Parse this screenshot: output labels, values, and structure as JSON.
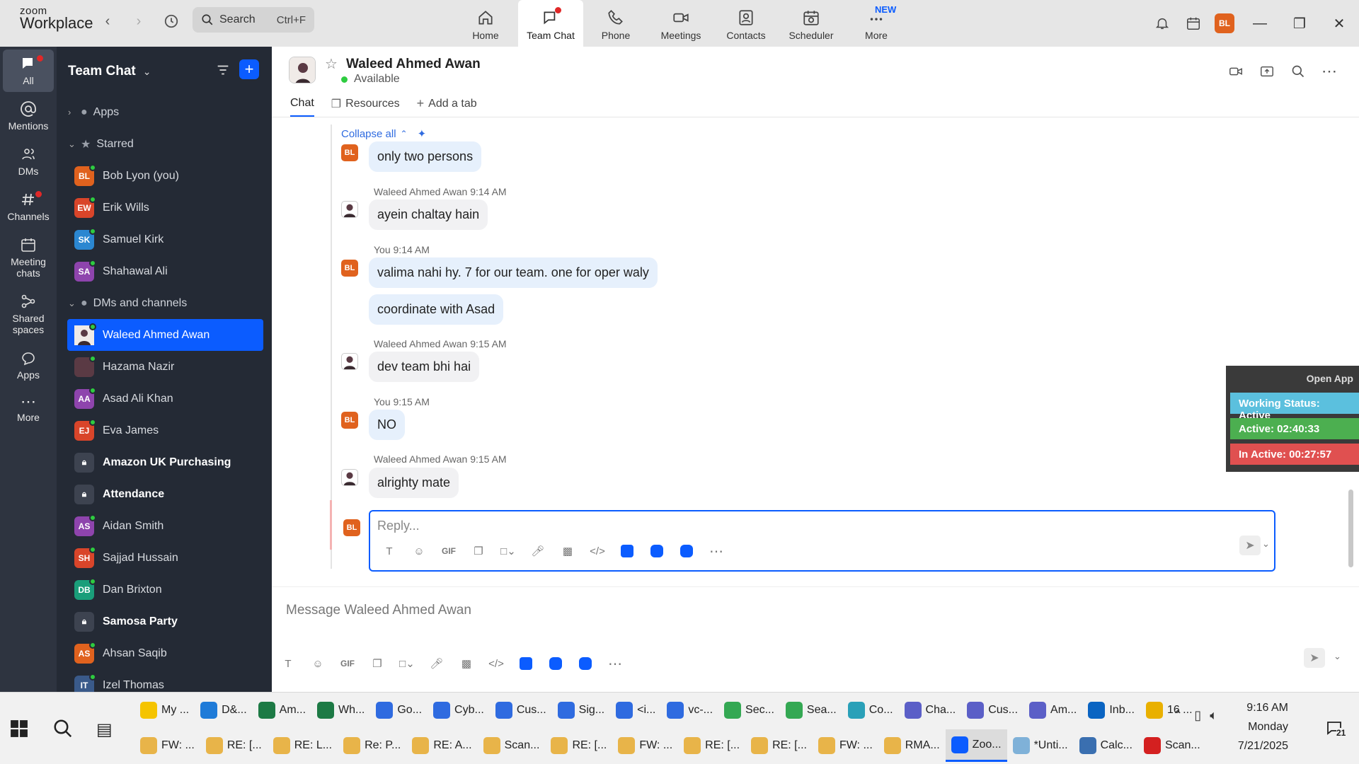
{
  "app": {
    "logo_top": "zoom",
    "logo_bottom": "Workplace"
  },
  "search": {
    "label": "Search",
    "shortcut": "Ctrl+F"
  },
  "tabs": [
    {
      "label": "Home"
    },
    {
      "label": "Team Chat"
    },
    {
      "label": "Phone"
    },
    {
      "label": "Meetings"
    },
    {
      "label": "Contacts"
    },
    {
      "label": "Scheduler"
    },
    {
      "label": "More",
      "badge": "NEW"
    }
  ],
  "user_avatar": "BL",
  "rail": [
    {
      "label": "All"
    },
    {
      "label": "Mentions"
    },
    {
      "label": "DMs"
    },
    {
      "label": "Channels"
    },
    {
      "label": "Meeting chats"
    },
    {
      "label": "Shared spaces"
    },
    {
      "label": "Apps"
    },
    {
      "label": "More"
    }
  ],
  "sidebar": {
    "title": "Team Chat",
    "sections": {
      "apps": "Apps",
      "starred": "Starred",
      "dms": "DMs and channels"
    },
    "starred": [
      {
        "initials": "BL",
        "name": "Bob Lyon (you)",
        "color": "#e0621e"
      },
      {
        "initials": "EW",
        "name": "Erik Wills",
        "color": "#d9452a"
      },
      {
        "initials": "SK",
        "name": "Samuel Kirk",
        "color": "#2b87d1"
      },
      {
        "initials": "SA",
        "name": "Shahawal Ali",
        "color": "#8e44ad"
      }
    ],
    "dms": [
      {
        "initials": "",
        "name": "Waleed Ahmed Awan",
        "color": "#ffffff",
        "selected": true
      },
      {
        "initials": "",
        "name": "Hazama Nazir",
        "color": "#5a3a44"
      },
      {
        "initials": "AA",
        "name": "Asad Ali Khan",
        "color": "#8e44ad"
      },
      {
        "initials": "EJ",
        "name": "Eva James",
        "color": "#d9452a"
      },
      {
        "initials": "",
        "name": "Amazon UK Purchasing",
        "color": "#3d4350",
        "lock": true
      },
      {
        "initials": "",
        "name": "Attendance",
        "color": "#3d4350",
        "lock": true
      },
      {
        "initials": "AS",
        "name": "Aidan Smith",
        "color": "#8e44ad"
      },
      {
        "initials": "SH",
        "name": "Sajjad Hussain",
        "color": "#d9452a"
      },
      {
        "initials": "DB",
        "name": "Dan Brixton",
        "color": "#1a9e7a"
      },
      {
        "initials": "",
        "name": "Samosa Party",
        "color": "#3d4350",
        "lock": true
      },
      {
        "initials": "AS",
        "name": "Ahsan Saqib",
        "color": "#e0621e"
      },
      {
        "initials": "IT",
        "name": "Izel Thomas",
        "color": "#3a5a8a"
      }
    ]
  },
  "chat": {
    "peer_name": "Waleed Ahmed Awan",
    "peer_status": "Available",
    "tabs": {
      "chat": "Chat",
      "resources": "Resources",
      "add": "Add a tab"
    },
    "collapse": "Collapse all",
    "messages": [
      {
        "text": "only two persons"
      },
      {
        "meta": "Waleed Ahmed Awan 9:14 AM",
        "text": "ayein chaltay hain"
      },
      {
        "meta": "You 9:14 AM",
        "text": "valima nahi hy. 7 for our team. one for oper waly"
      },
      {
        "text": "coordinate with Asad"
      },
      {
        "meta": "Waleed Ahmed Awan 9:15 AM",
        "text": "dev team bhi hai"
      },
      {
        "meta": "You 9:15 AM",
        "text": "NO"
      },
      {
        "meta": "Waleed Ahmed Awan 9:15 AM",
        "text": "alrighty mate"
      }
    ],
    "reply_placeholder": "Reply...",
    "composer_placeholder": "Message Waleed Ahmed Awan",
    "gif": "GIF"
  },
  "widget": {
    "open": "Open App",
    "status": "Working Status: Active",
    "active": "Active: 02:40:33",
    "inactive": "In Active: 00:27:57"
  },
  "taskbar": {
    "row1": [
      {
        "label": "My ...",
        "color": "#f5c400"
      },
      {
        "label": "D&...",
        "color": "#1f7bd8"
      },
      {
        "label": "Am...",
        "color": "#1d7a45"
      },
      {
        "label": "Wh...",
        "color": "#1d7a45"
      },
      {
        "label": "Go...",
        "color": "#2f6be0"
      },
      {
        "label": "Cyb...",
        "color": "#2f6be0"
      },
      {
        "label": "Cus...",
        "color": "#2f6be0"
      },
      {
        "label": "Sig...",
        "color": "#2f6be0"
      },
      {
        "label": "<i...",
        "color": "#2f6be0"
      },
      {
        "label": "vc-...",
        "color": "#2f6be0"
      },
      {
        "label": "Sec...",
        "color": "#34a853"
      },
      {
        "label": "Sea...",
        "color": "#34a853"
      },
      {
        "label": "Co...",
        "color": "#2aa0b8"
      },
      {
        "label": "Cha...",
        "color": "#5b5fc7"
      },
      {
        "label": "Cus...",
        "color": "#5b5fc7"
      },
      {
        "label": "Am...",
        "color": "#5b5fc7"
      },
      {
        "label": "Inb...",
        "color": "#0a64c2"
      },
      {
        "label": "16 ...",
        "color": "#e9b000"
      }
    ],
    "row2": [
      {
        "label": "FW: ...",
        "color": "#e8b449"
      },
      {
        "label": "RE: [...",
        "color": "#e8b449"
      },
      {
        "label": "RE: L...",
        "color": "#e8b449"
      },
      {
        "label": "Re: P...",
        "color": "#e8b449"
      },
      {
        "label": "RE: A...",
        "color": "#e8b449"
      },
      {
        "label": "Scan...",
        "color": "#e8b449"
      },
      {
        "label": "RE: [...",
        "color": "#e8b449"
      },
      {
        "label": "FW: ...",
        "color": "#e8b449"
      },
      {
        "label": "RE: [...",
        "color": "#e8b449"
      },
      {
        "label": "RE: [...",
        "color": "#e8b449"
      },
      {
        "label": "FW: ...",
        "color": "#e8b449"
      },
      {
        "label": "RMA...",
        "color": "#e8b449"
      },
      {
        "label": "Zoo...",
        "color": "#0b5cff",
        "active": true
      },
      {
        "label": "*Unti...",
        "color": "#7fb1d8"
      },
      {
        "label": "Calc...",
        "color": "#3a6fb0"
      },
      {
        "label": "Scan...",
        "color": "#d42020"
      }
    ],
    "time": "9:16 AM",
    "day": "Monday",
    "date": "7/21/2025",
    "notif_count": "21"
  }
}
